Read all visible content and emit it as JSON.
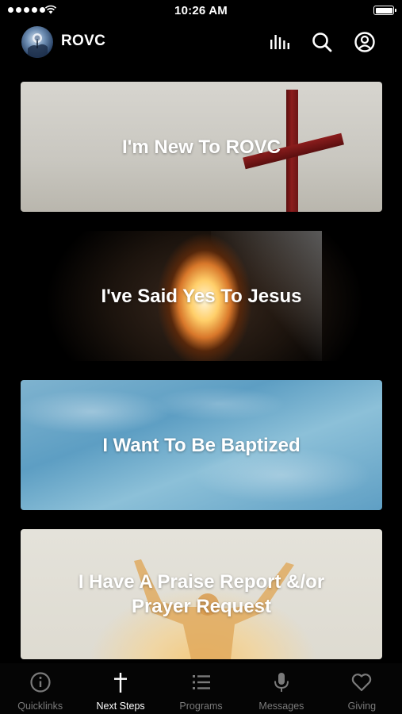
{
  "status_bar": {
    "time": "10:26 AM",
    "battery_level": 1.0
  },
  "header": {
    "title": "ROVC",
    "icons": [
      "equalizer-icon",
      "search-icon",
      "account-icon"
    ]
  },
  "cards": [
    {
      "title": "I'm New To ROVC",
      "image": "cross"
    },
    {
      "title": "I've Said Yes To Jesus",
      "image": "empty-tomb"
    },
    {
      "title": "I Want To Be Baptized",
      "image": "water"
    },
    {
      "title": "I Have A Praise Report &/or\nPrayer Request",
      "image": "raised-hands"
    }
  ],
  "tab_bar": {
    "active_index": 1,
    "tabs": [
      {
        "label": "Quicklinks",
        "icon": "info-icon"
      },
      {
        "label": "Next Steps",
        "icon": "cross-icon"
      },
      {
        "label": "Programs",
        "icon": "list-icon"
      },
      {
        "label": "Messages",
        "icon": "microphone-icon"
      },
      {
        "label": "Giving",
        "icon": "heart-icon"
      }
    ]
  },
  "colors": {
    "background": "#000000",
    "active_tab": "#ffffff",
    "inactive_tab": "#7a7a7a"
  }
}
